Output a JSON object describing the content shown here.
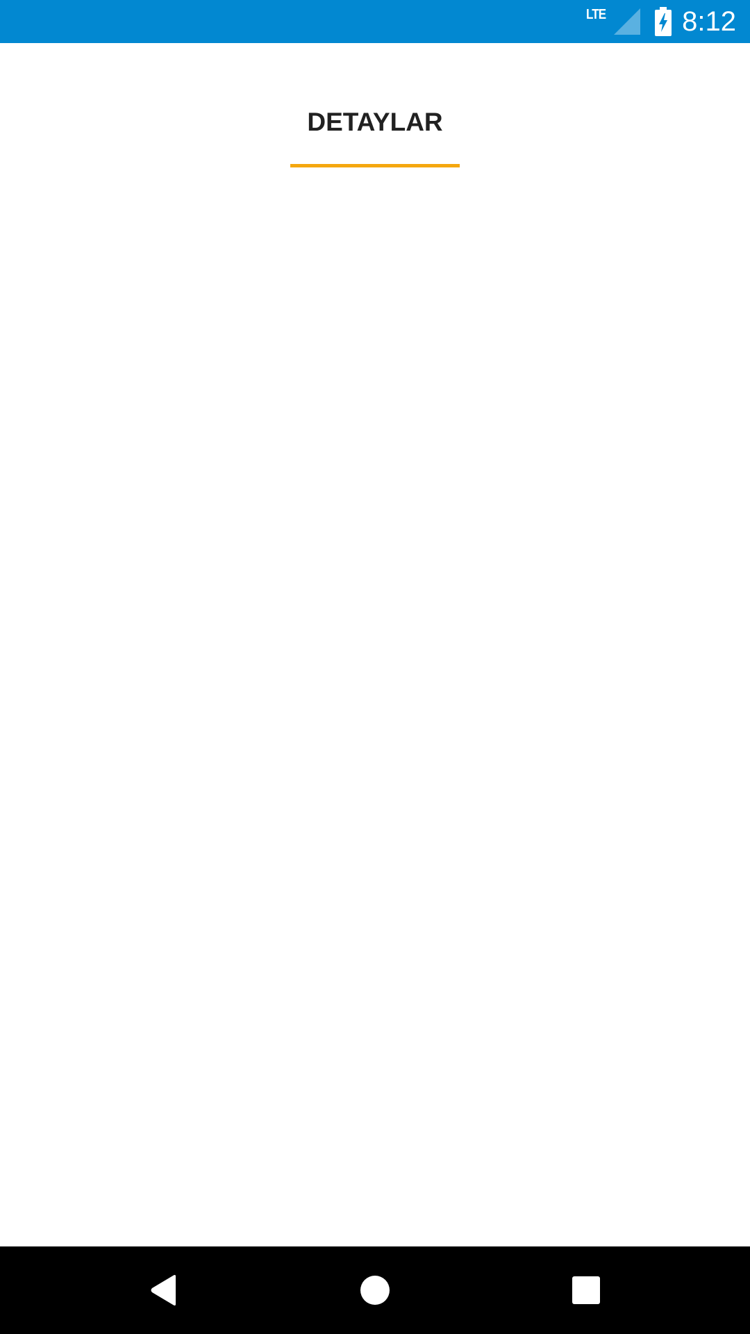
{
  "status_bar": {
    "network_type": "LTE",
    "time": "8:12",
    "background_color": "#0288d1",
    "icons": [
      "signal-icon",
      "battery-charging-icon"
    ]
  },
  "tabs": [
    {
      "label": "DETAYLAR",
      "selected": true,
      "indicator_color": "#f5a70f"
    }
  ],
  "nav_bar": {
    "buttons": [
      "back-icon",
      "home-icon",
      "recents-icon"
    ]
  }
}
